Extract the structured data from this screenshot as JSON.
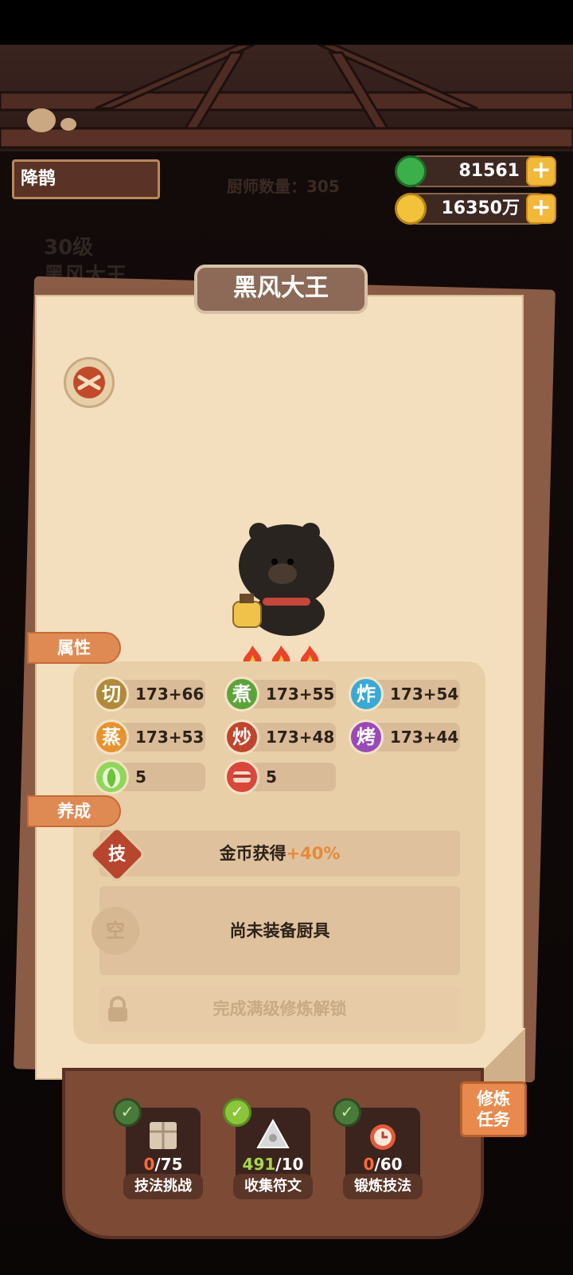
{
  "header": {
    "player_name": "降鹊",
    "chef_count": "厨师数量：305",
    "jade_amount": "81561",
    "coin_amount": "16350万",
    "bg_level": "30级",
    "bg_chef_name": "黑风大王"
  },
  "chef": {
    "name": "黑风大王",
    "flames": 3
  },
  "sections": {
    "attributes": "属性",
    "cultivation": "养成"
  },
  "stats": [
    {
      "skill": "切",
      "value": "173+66",
      "color": "#b08a3a"
    },
    {
      "skill": "煮",
      "value": "173+55",
      "color": "#5ba43a"
    },
    {
      "skill": "炸",
      "value": "173+54",
      "color": "#3aa9d6"
    },
    {
      "skill": "蒸",
      "value": "173+53",
      "color": "#e8922e"
    },
    {
      "skill": "炒",
      "value": "173+48",
      "color": "#c0442e"
    },
    {
      "skill": "烤",
      "value": "173+44",
      "color": "#9a4ab8"
    }
  ],
  "ingredients": [
    {
      "icon": "cabbage-icon",
      "value": "5"
    },
    {
      "icon": "meat-icon",
      "value": "5"
    }
  ],
  "cultivation": {
    "skill_icon": "技",
    "skill_text": "金币获得",
    "skill_bonus": "+40%",
    "equip_icon": "空",
    "equip_text": "尚未装备厨具",
    "locked_text": "完成满级修炼解锁"
  },
  "tasks": [
    {
      "done": "0",
      "total": "/75",
      "label": "技法挑战"
    },
    {
      "done": "491",
      "total": "/10",
      "label": "收集符文"
    },
    {
      "done": "0",
      "total": "/60",
      "label": "锻炼技法"
    }
  ],
  "train_button": "修炼\n任务",
  "colors": {
    "accent_orange": "#e08a53",
    "bonus_orange": "#e58a3a",
    "task_done_green": "#a6d84a",
    "task_zero_red": "#ff6a3a"
  }
}
